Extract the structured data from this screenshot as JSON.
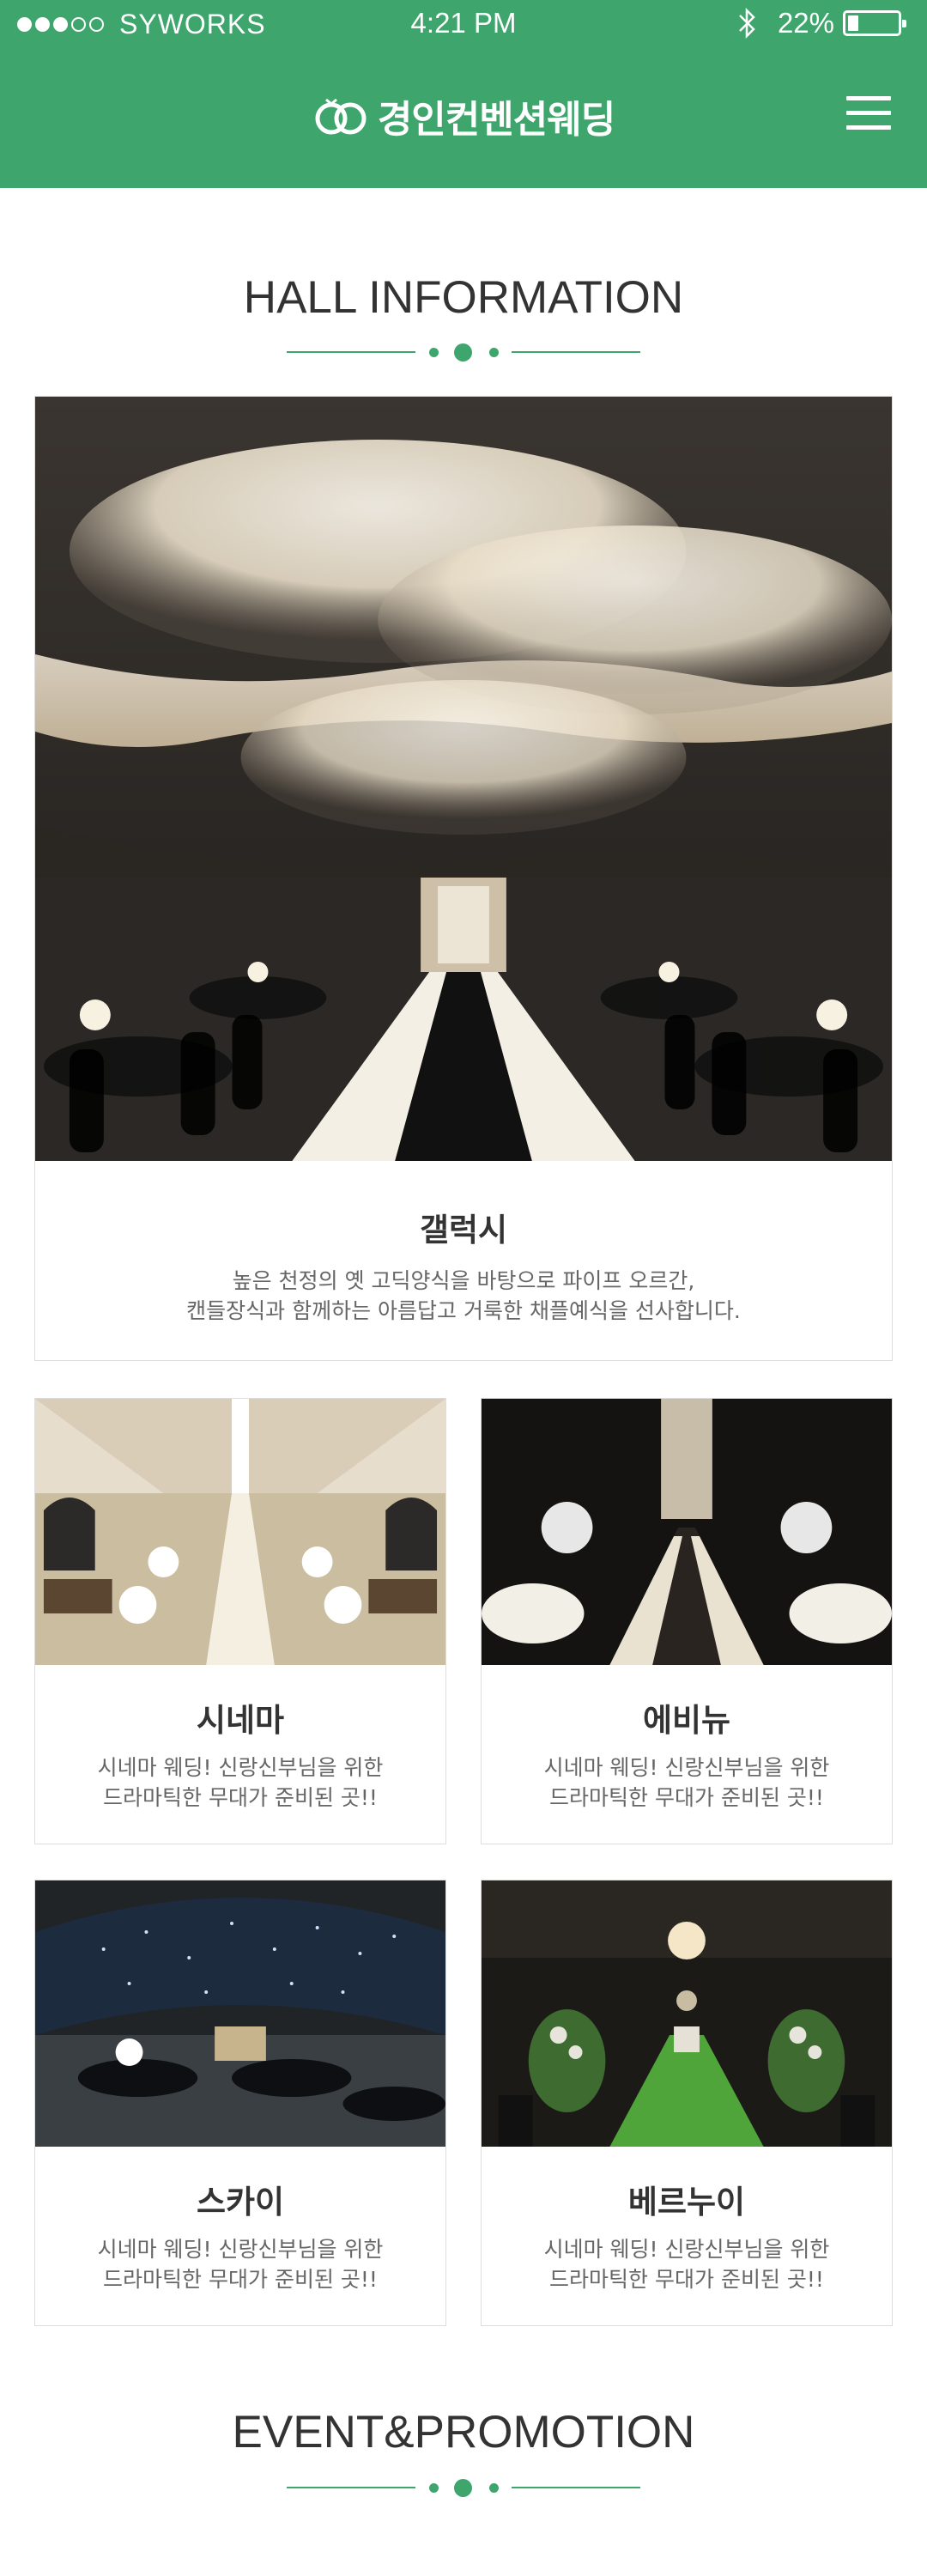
{
  "status_bar": {
    "carrier": "SYWORKS",
    "time": "4:21 PM",
    "battery": "22%",
    "battery_level": 0.22
  },
  "header": {
    "brand": "경인컨벤션웨딩",
    "logo_icon": "double-ring-icon",
    "menu_icon": "hamburger-menu-icon",
    "bg_color": "#3ea56d"
  },
  "hall_section": {
    "title": "HALL INFORMATION",
    "featured": {
      "name": "갤럭시",
      "desc_line1": "높은 천정의 옛 고딕양식을 바탕으로 파이프 오르간,",
      "desc_line2": "캔들장식과 함께하는 아름답고 거룩한 채플예식을 선사합니다."
    },
    "halls": [
      {
        "name": "시네마",
        "desc_line1": "시네마 웨딩! 신랑신부님을 위한",
        "desc_line2": "드라마틱한 무대가 준비된 곳!!"
      },
      {
        "name": "에비뉴",
        "desc_line1": "시네마 웨딩! 신랑신부님을 위한",
        "desc_line2": "드라마틱한 무대가 준비된 곳!!"
      },
      {
        "name": "스카이",
        "desc_line1": "시네마 웨딩! 신랑신부님을 위한",
        "desc_line2": "드라마틱한 무대가 준비된 곳!!"
      },
      {
        "name": "베르누이",
        "desc_line1": "시네마 웨딩! 신랑신부님을 위한",
        "desc_line2": "드라마틱한 무대가 준비된 곳!!"
      }
    ]
  },
  "event_section": {
    "title": "EVENT&PROMOTION"
  }
}
